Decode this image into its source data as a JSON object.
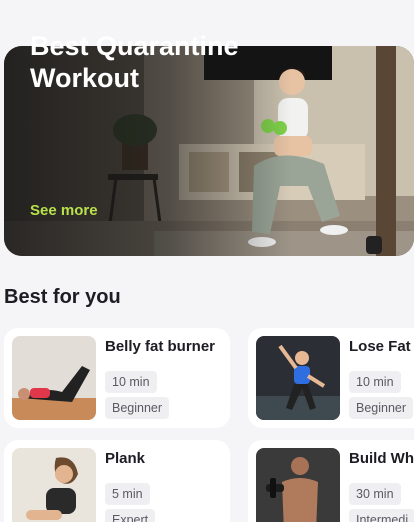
{
  "hero": {
    "title": "Best Quarantine Workout",
    "link_label": "See more"
  },
  "section": {
    "title": "Best for you"
  },
  "cards": [
    {
      "title": "Belly fat burner",
      "duration": "10 min",
      "level": "Beginner"
    },
    {
      "title": "Lose Fat",
      "duration": "10 min",
      "level": "Beginner"
    },
    {
      "title": "Plank",
      "duration": "5 min",
      "level": "Expert"
    },
    {
      "title": "Build Wh",
      "duration": "30 min",
      "level": "Intermedi"
    }
  ],
  "colors": {
    "accent": "#b8e04a",
    "background": "#f5f5f8",
    "card": "#ffffff",
    "tag": "#efeff1"
  }
}
